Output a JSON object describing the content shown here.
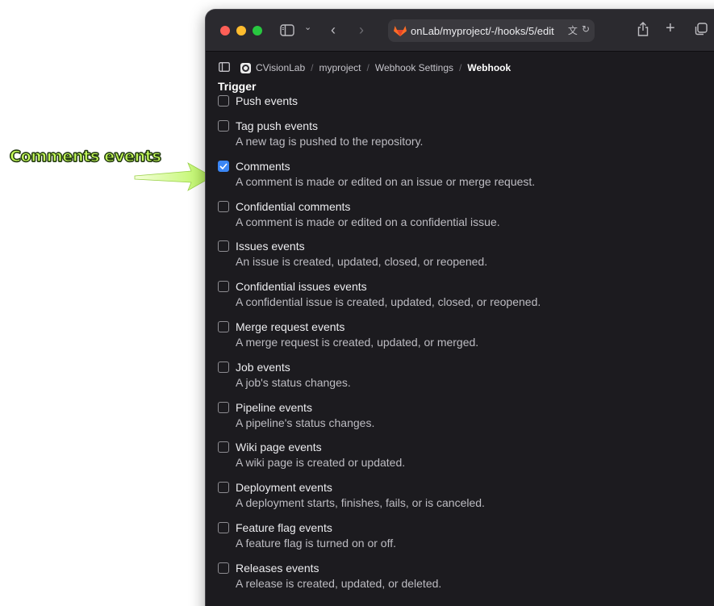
{
  "annotation": {
    "text": "Comments events",
    "color": "#c8ff5a"
  },
  "browser": {
    "url": "onLab/myproject/-/hooks/5/edit"
  },
  "breadcrumb": {
    "items": [
      "CVisionLab",
      "myproject",
      "Webhook Settings",
      "Webhook"
    ]
  },
  "section": {
    "title": "Trigger"
  },
  "triggers": [
    {
      "label": "Push events",
      "description": "",
      "checked": false
    },
    {
      "label": "Tag push events",
      "description": "A new tag is pushed to the repository.",
      "checked": false
    },
    {
      "label": "Comments",
      "description": "A comment is made or edited on an issue or merge request.",
      "checked": true
    },
    {
      "label": "Confidential comments",
      "description": "A comment is made or edited on a confidential issue.",
      "checked": false
    },
    {
      "label": "Issues events",
      "description": "An issue is created, updated, closed, or reopened.",
      "checked": false
    },
    {
      "label": "Confidential issues events",
      "description": "A confidential issue is created, updated, closed, or reopened.",
      "checked": false
    },
    {
      "label": "Merge request events",
      "description": "A merge request is created, updated, or merged.",
      "checked": false
    },
    {
      "label": "Job events",
      "description": "A job's status changes.",
      "checked": false
    },
    {
      "label": "Pipeline events",
      "description": "A pipeline's status changes.",
      "checked": false
    },
    {
      "label": "Wiki page events",
      "description": "A wiki page is created or updated.",
      "checked": false
    },
    {
      "label": "Deployment events",
      "description": "A deployment starts, finishes, fails, or is canceled.",
      "checked": false
    },
    {
      "label": "Feature flag events",
      "description": "A feature flag is turned on or off.",
      "checked": false
    },
    {
      "label": "Releases events",
      "description": "A release is created, updated, or deleted.",
      "checked": false
    }
  ],
  "colors": {
    "checkbox_checked": "#3a86f5",
    "background": "#1c1b1f"
  }
}
